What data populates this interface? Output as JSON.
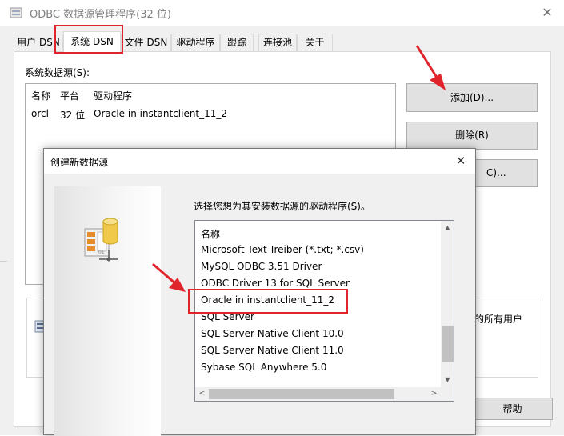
{
  "main_window": {
    "title": "ODBC 数据源管理程序(32 位)",
    "close_glyph": "✕"
  },
  "tabs": [
    {
      "label": "用户 DSN"
    },
    {
      "label": "系统 DSN"
    },
    {
      "label": "文件 DSN"
    },
    {
      "label": "驱动程序"
    },
    {
      "label": "跟踪"
    },
    {
      "label": "连接池"
    },
    {
      "label": "关于"
    }
  ],
  "system_dsn": {
    "list_label": "系统数据源(S):",
    "columns": [
      "名称",
      "平台",
      "驱动程序"
    ],
    "rows": [
      {
        "name": "orcl",
        "platform": "32 位",
        "driver": "Oracle in instantclient_11_2"
      }
    ]
  },
  "buttons": {
    "add": "添加(D)...",
    "remove": "删除(R)",
    "configure": "C)...",
    "help": "帮助"
  },
  "info_text_fragment": "的所有用户",
  "dialog": {
    "title": "创建新数据源",
    "close_glyph": "✕",
    "prompt": "选择您想为其安装数据源的驱动程序(S)。",
    "list_header": "名称",
    "drivers": [
      "Microsoft Text-Treiber (*.txt; *.csv)",
      "MySQL ODBC 3.51 Driver",
      "ODBC Driver 13 for SQL Server",
      "Oracle in instantclient_11_2",
      "SQL Server",
      "SQL Server Native Client 10.0",
      "SQL Server Native Client 11.0",
      "Sybase SQL Anywhere 5.0"
    ]
  },
  "scroll": {
    "up": "▲",
    "down": "▼",
    "left": "<",
    "right": ">"
  },
  "annotation_color": "#e0242b"
}
